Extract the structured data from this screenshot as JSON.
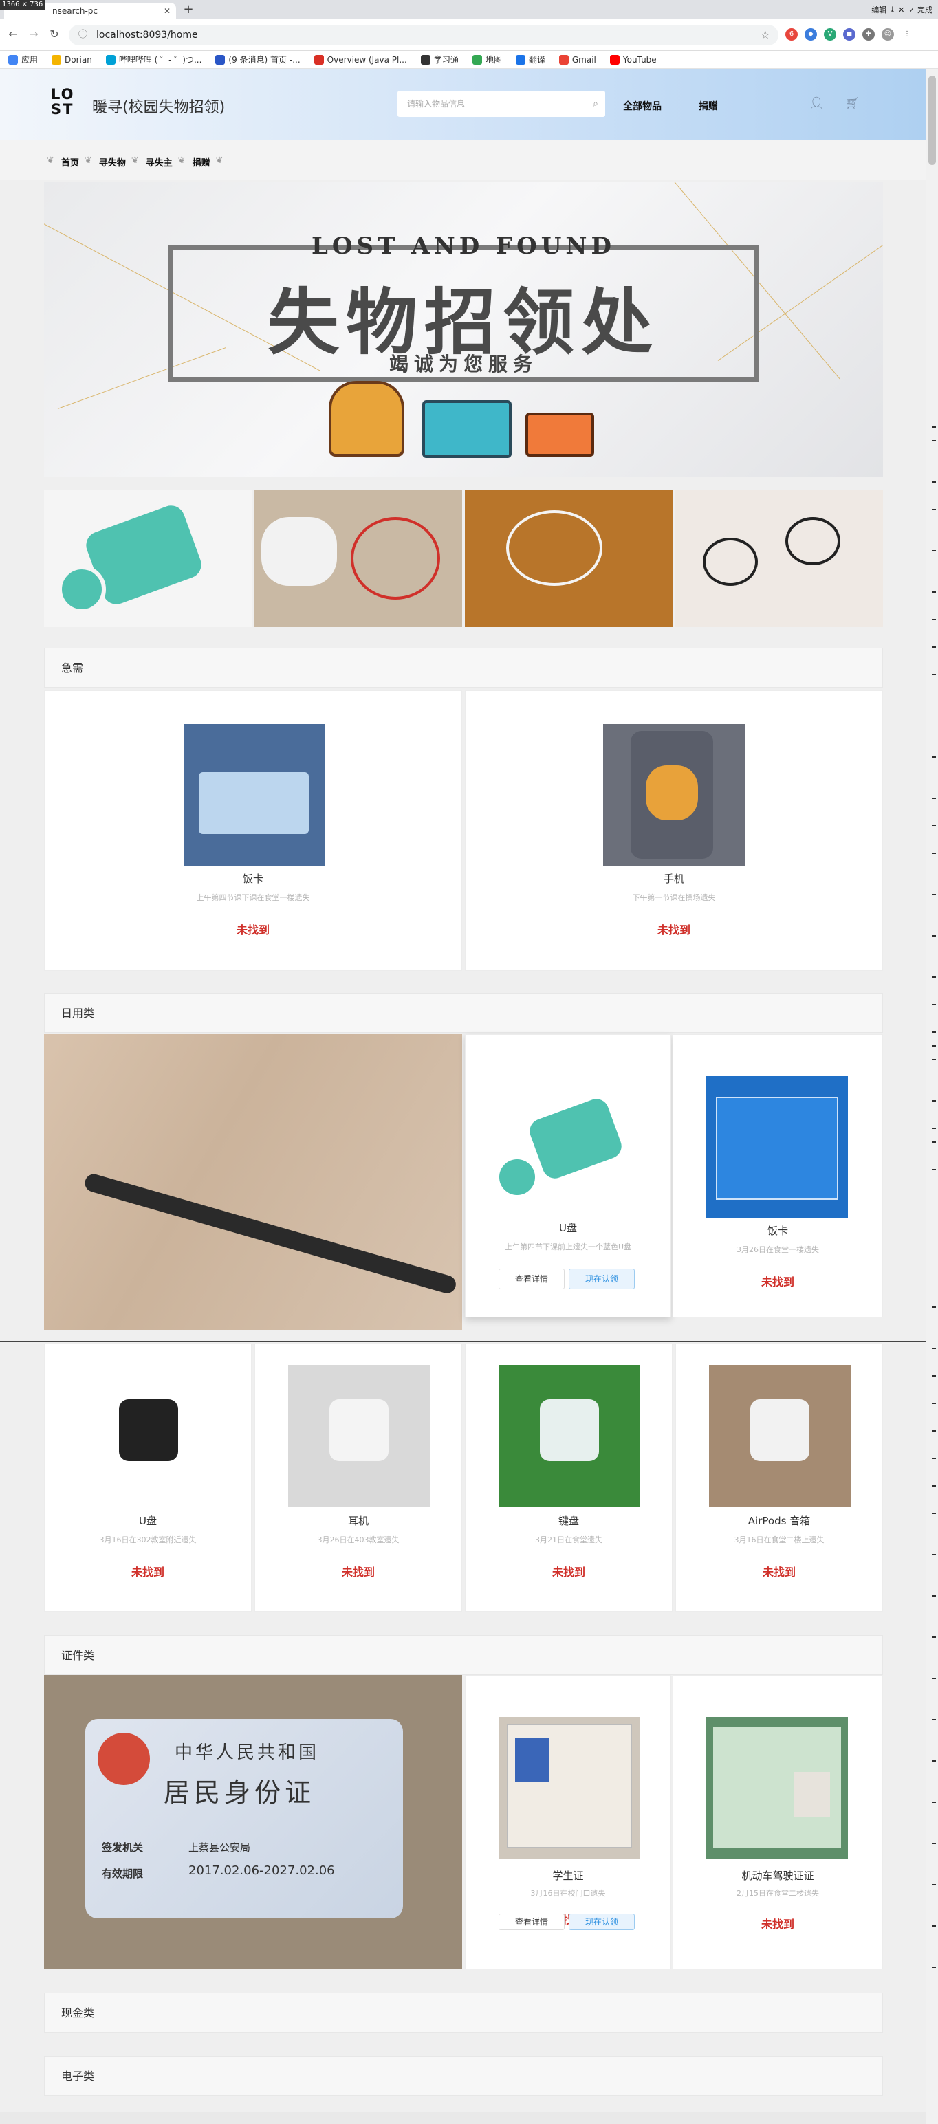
{
  "browser": {
    "size_chip": "1366 × 736",
    "tab_title": "nsearch-pc",
    "new_tab": "+",
    "url": "localhost:8093/home",
    "window_controls": [
      "编辑",
      "⤓",
      "✕",
      "✓ 完成"
    ],
    "bookmarks": [
      {
        "label": "应用",
        "color": "#4285f4"
      },
      {
        "label": "Dorian",
        "color": "#f4b400"
      },
      {
        "label": "哔哩哔哩 ( ゜- ゜)つ...",
        "color": "#00a1d6"
      },
      {
        "label": "(9 条消息) 首页 -...",
        "color": "#2a56c6"
      },
      {
        "label": "Overview (Java Pl...",
        "color": "#d93025"
      },
      {
        "label": "学习通",
        "color": "#333333"
      },
      {
        "label": "地图",
        "color": "#34a853"
      },
      {
        "label": "翻译",
        "color": "#1a73e8"
      },
      {
        "label": "Gmail",
        "color": "#ea4335"
      },
      {
        "label": "YouTube",
        "color": "#ff0000"
      }
    ]
  },
  "site": {
    "logo_line1": "LO",
    "logo_line2": "ST",
    "brand": "暖寻(校园失物招领)",
    "search_placeholder": "请输入物品信息",
    "nav_all": "全部物品",
    "nav_donate": "捐赠",
    "breadcrumbs": [
      "首页",
      "寻失物",
      "寻失主",
      "捐赠"
    ]
  },
  "banner": {
    "en_title": "LOST AND FOUND",
    "cn_title": "失物招领处",
    "subtitle": "竭诚为您服务"
  },
  "sections": {
    "urgent": {
      "title": "急需",
      "items": [
        {
          "title": "饭卡",
          "desc": "上午第四节课下课在食堂一楼遗失",
          "status": "未找到"
        },
        {
          "title": "手机",
          "desc": "下午第一节课在操场遗失",
          "status": "未找到"
        }
      ]
    },
    "daily": {
      "title": "日用类",
      "featured": {
        "title": "U盘",
        "desc": "上午第四节下课前上遗失一个蓝色U盘",
        "btn_detail": "查看详情",
        "btn_claim": "现在认领"
      },
      "side": {
        "title": "饭卡",
        "desc": "3月26日在食堂一楼遗失",
        "status": "未找到"
      },
      "row": [
        {
          "title": "U盘",
          "desc": "3月16日在302教室附近遗失",
          "status": "未找到"
        },
        {
          "title": "耳机",
          "desc": "3月26日在403教室遗失",
          "status": "未找到"
        },
        {
          "title": "键盘",
          "desc": "3月21日在食堂遗失",
          "status": "未找到"
        },
        {
          "title": "AirPods 音箱",
          "desc": "3月16日在食堂二楼上遗失",
          "status": "未找到"
        }
      ]
    },
    "certificate": {
      "title": "证件类",
      "id_card": {
        "country": "中华人民共和国",
        "name": "居民身份证",
        "authority_label": "签发机关",
        "authority": "上蔡县公安局",
        "validity_label": "有效期限",
        "validity": "2017.02.06-2027.02.06"
      },
      "items": [
        {
          "title": "学生证",
          "desc": "3月16日在校门口遗失",
          "btn_detail": "查看详情",
          "btn_claim": "现在认领",
          "status": "未找到"
        },
        {
          "title": "机动车驾驶证证",
          "desc": "2月15日在食堂二楼遗失",
          "status": "未找到"
        }
      ]
    },
    "cash": {
      "title": "现金类"
    },
    "electronic": {
      "title": "电子类"
    }
  }
}
